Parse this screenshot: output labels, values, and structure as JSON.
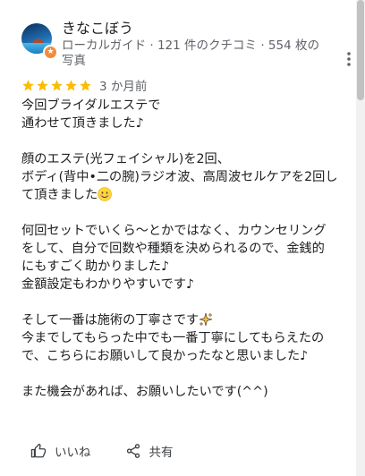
{
  "author": {
    "name": "きなこぼう",
    "meta": "ローカルガイド · 121 件のクチコミ · 554 枚の写真"
  },
  "review": {
    "rating": 5,
    "max_rating": 5,
    "date": "3 か月前",
    "paragraphs": [
      [
        "今回ブライダルエステで",
        "通わせて頂きました♪"
      ],
      [
        "顔のエステ(光フェイシャル)を2回、",
        "ボディ(背中•二の腕)ラジオ波、高周波セルケアを2回し",
        "て頂きました"
      ],
      [
        "何回セットでいくら〜とかではなく、カウンセリング",
        "をして、自分で回数や種類を決められるので、金銭的",
        "にもすごく助かりました♪",
        "金額設定もわかりやすいです♪"
      ],
      [
        "そして一番は施術の丁寧さです",
        "今までしてもらった中でも一番丁寧にしてもらえたの",
        "で、こちらにお願いして良かったなと思いました♪"
      ],
      [
        "また機会があれば、お願いしたいです(^^)"
      ]
    ]
  },
  "actions": {
    "like_label": "いいね",
    "share_label": "共有"
  },
  "colors": {
    "star": "#fbbc04",
    "text": "#202124",
    "secondary_text": "#5f6368",
    "badge": "#f28b3b"
  },
  "icons": {
    "more": "more-vert-icon",
    "like": "thumb-up-icon",
    "share": "share-icon",
    "smile": "smiling-face-emoji",
    "sparkles": "sparkles-emoji"
  }
}
